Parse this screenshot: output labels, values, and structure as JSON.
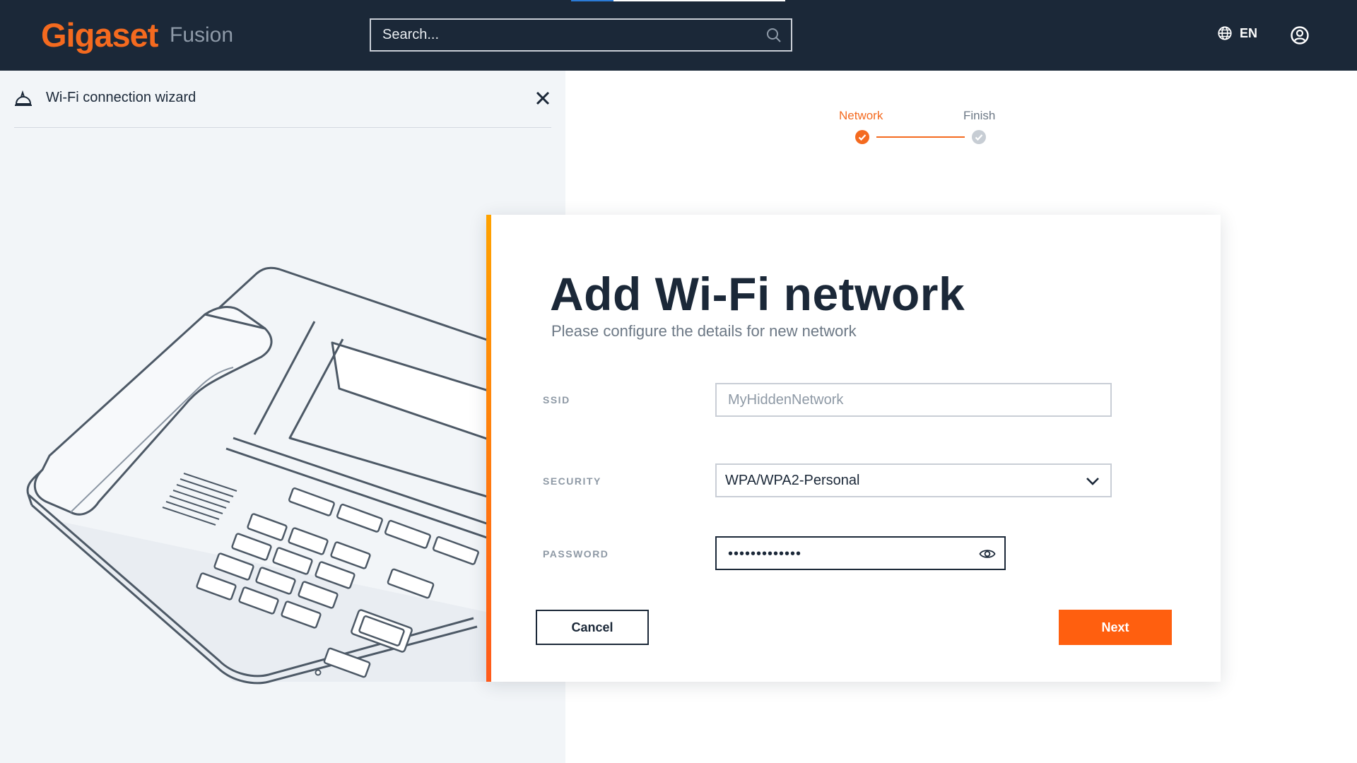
{
  "header": {
    "brand": "Gigaset",
    "product": "Fusion",
    "search_placeholder": "Search...",
    "language": "EN"
  },
  "wizard": {
    "title": "Wi-Fi connection wizard"
  },
  "stepper": {
    "steps": [
      {
        "label": "Network",
        "state": "active"
      },
      {
        "label": "Finish",
        "state": "inactive"
      }
    ]
  },
  "form": {
    "title": "Add Wi-Fi network",
    "subtitle": "Please configure the details for new network",
    "ssid": {
      "label": "SSID",
      "placeholder": "MyHiddenNetwork",
      "value": ""
    },
    "security": {
      "label": "SECURITY",
      "selected": "WPA/WPA2-Personal"
    },
    "password": {
      "label": "PASSWORD",
      "masked": "•••••••••••••"
    },
    "cancel_label": "Cancel",
    "next_label": "Next"
  },
  "colors": {
    "topbar": "#1b2838",
    "accent": "#f46a1f",
    "button_primary": "#ff5f0f",
    "panel_bg": "#f2f5f8"
  }
}
